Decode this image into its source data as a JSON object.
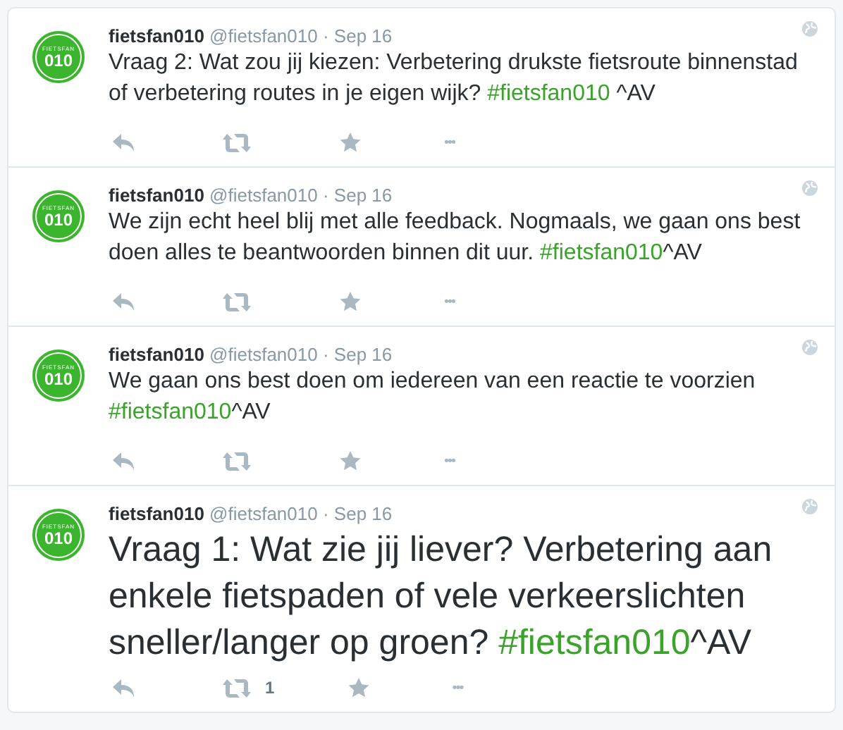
{
  "tweets": [
    {
      "avatar": {
        "label": "FIETSFAN",
        "number": "010"
      },
      "name": "fietsfan010",
      "handle": "@fietsfan010",
      "date": "· Sep 16",
      "large": false,
      "parts": [
        {
          "kind": "plain",
          "text": "Vraag 2: Wat zou jij kiezen: Verbetering drukste fietsroute binnenstad of verbetering routes in je eigen wijk? "
        },
        {
          "kind": "hashtag",
          "text": "#fietsfan010"
        },
        {
          "kind": "plain",
          "text": " ^AV"
        }
      ],
      "actions": {
        "more": "•••"
      }
    },
    {
      "avatar": {
        "label": "FIETSFAN",
        "number": "010"
      },
      "name": "fietsfan010",
      "handle": "@fietsfan010",
      "date": "· Sep 16",
      "large": false,
      "parts": [
        {
          "kind": "plain",
          "text": "We zijn echt heel blij met alle feedback. Nogmaals, we gaan ons best doen alles te beantwoorden binnen dit uur. "
        },
        {
          "kind": "hashtag",
          "text": "#fietsfan010"
        },
        {
          "kind": "plain",
          "text": "^AV"
        }
      ],
      "actions": {
        "more": "•••"
      }
    },
    {
      "avatar": {
        "label": "FIETSFAN",
        "number": "010"
      },
      "name": "fietsfan010",
      "handle": "@fietsfan010",
      "date": "· Sep 16",
      "large": false,
      "parts": [
        {
          "kind": "plain",
          "text": "We gaan ons best doen om iedereen van een reactie te voorzien "
        },
        {
          "kind": "hashtag",
          "text": "#fietsfan010"
        },
        {
          "kind": "plain",
          "text": "^AV"
        }
      ],
      "actions": {
        "more": "•••"
      }
    },
    {
      "avatar": {
        "label": "FIETSFAN",
        "number": "010"
      },
      "name": "fietsfan010",
      "handle": "@fietsfan010",
      "date": "· Sep 16",
      "large": true,
      "parts": [
        {
          "kind": "plain",
          "text": "Vraag 1: Wat zie jij liever? Verbetering aan enkele fietspaden of vele verkeerslichten sneller/langer op groen? "
        },
        {
          "kind": "hashtag",
          "text": "#fietsfan010"
        },
        {
          "kind": "plain",
          "text": "^AV"
        }
      ],
      "actions": {
        "retweets": "1",
        "more": "•••"
      }
    }
  ]
}
